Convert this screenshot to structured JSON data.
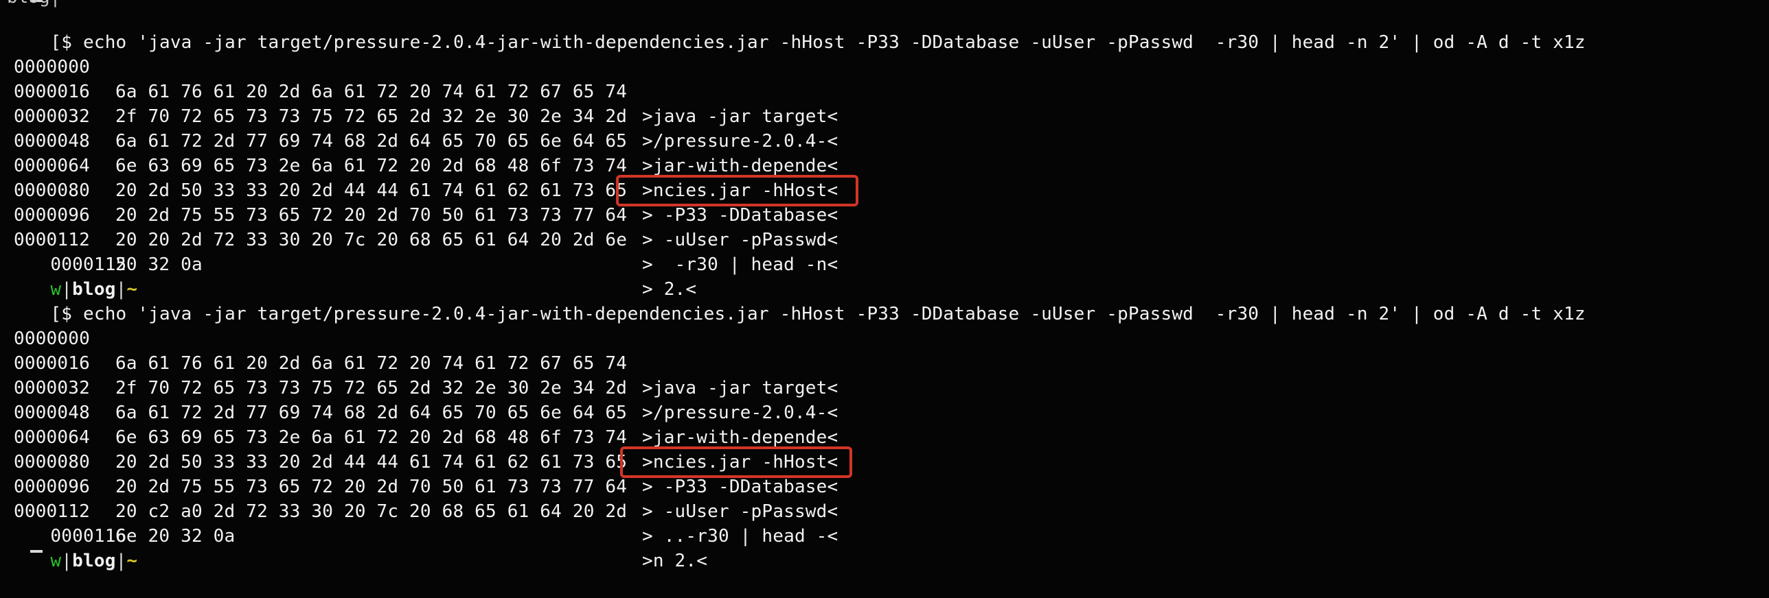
{
  "terminal": {
    "prompt_symbol": "[$",
    "command": "echo 'java -jar target/pressure-2.0.4-jar-with-dependencies.jar -hHost -P33 -DDatabase -uUser -pPasswd  -r30 | head -n 2' | od -A d -t x1z",
    "prompt": {
      "user": "w",
      "separator": "|",
      "dir": "blog",
      "tilde": "~"
    },
    "blocks": [
      {
        "rows": [
          {
            "offset": "0000000",
            "hex": "6a 61 76 61 20 2d 6a 61 72 20 74 61 72 67 65 74",
            "ascii": ">java -jar target<"
          },
          {
            "offset": "0000016",
            "hex": "2f 70 72 65 73 73 75 72 65 2d 32 2e 30 2e 34 2d",
            "ascii": ">/pressure-2.0.4-<"
          },
          {
            "offset": "0000032",
            "hex": "6a 61 72 2d 77 69 74 68 2d 64 65 70 65 6e 64 65",
            "ascii": ">jar-with-depende<"
          },
          {
            "offset": "0000048",
            "hex": "6e 63 69 65 73 2e 6a 61 72 20 2d 68 48 6f 73 74",
            "ascii": ">ncies.jar -hHost<"
          },
          {
            "offset": "0000064",
            "hex": "20 2d 50 33 33 20 2d 44 44 61 74 61 62 61 73 65",
            "ascii": "> -P33 -DDatabase<"
          },
          {
            "offset": "0000080",
            "hex": "20 2d 75 55 73 65 72 20 2d 70 50 61 73 73 77 64",
            "ascii": "> -uUser -pPasswd<"
          },
          {
            "offset": "0000096",
            "hex": "20 20 2d 72 33 30 20 7c 20 68 65 61 64 20 2d 6e",
            "ascii": ">  -r30 | head -n<"
          },
          {
            "offset": "0000112",
            "hex": "20 32 0a",
            "ascii": "> 2.<"
          }
        ],
        "end_offset": "0000115"
      },
      {
        "rows": [
          {
            "offset": "0000000",
            "hex": "6a 61 76 61 20 2d 6a 61 72 20 74 61 72 67 65 74",
            "ascii": ">java -jar target<"
          },
          {
            "offset": "0000016",
            "hex": "2f 70 72 65 73 73 75 72 65 2d 32 2e 30 2e 34 2d",
            "ascii": ">/pressure-2.0.4-<"
          },
          {
            "offset": "0000032",
            "hex": "6a 61 72 2d 77 69 74 68 2d 64 65 70 65 6e 64 65",
            "ascii": ">jar-with-depende<"
          },
          {
            "offset": "0000048",
            "hex": "6e 63 69 65 73 2e 6a 61 72 20 2d 68 48 6f 73 74",
            "ascii": ">ncies.jar -hHost<"
          },
          {
            "offset": "0000064",
            "hex": "20 2d 50 33 33 20 2d 44 44 61 74 61 62 61 73 65",
            "ascii": "> -P33 -DDatabase<"
          },
          {
            "offset": "0000080",
            "hex": "20 2d 75 55 73 65 72 20 2d 70 50 61 73 73 77 64",
            "ascii": "> -uUser -pPasswd<"
          },
          {
            "offset": "0000096",
            "hex": "20 c2 a0 2d 72 33 30 20 7c 20 68 65 61 64 20 2d",
            "ascii": "> ..-r30 | head -<"
          },
          {
            "offset": "0000112",
            "hex": "6e 20 32 0a",
            "ascii": ">n 2.<"
          }
        ],
        "end_offset": "0000116"
      }
    ],
    "top_fragment": "blog|",
    "highlight_color": "#d33528",
    "colors": {
      "background": "#050505",
      "text": "#f2f2f2",
      "prompt_user": "#29c22a",
      "prompt_tilde": "#d8c52a"
    }
  }
}
